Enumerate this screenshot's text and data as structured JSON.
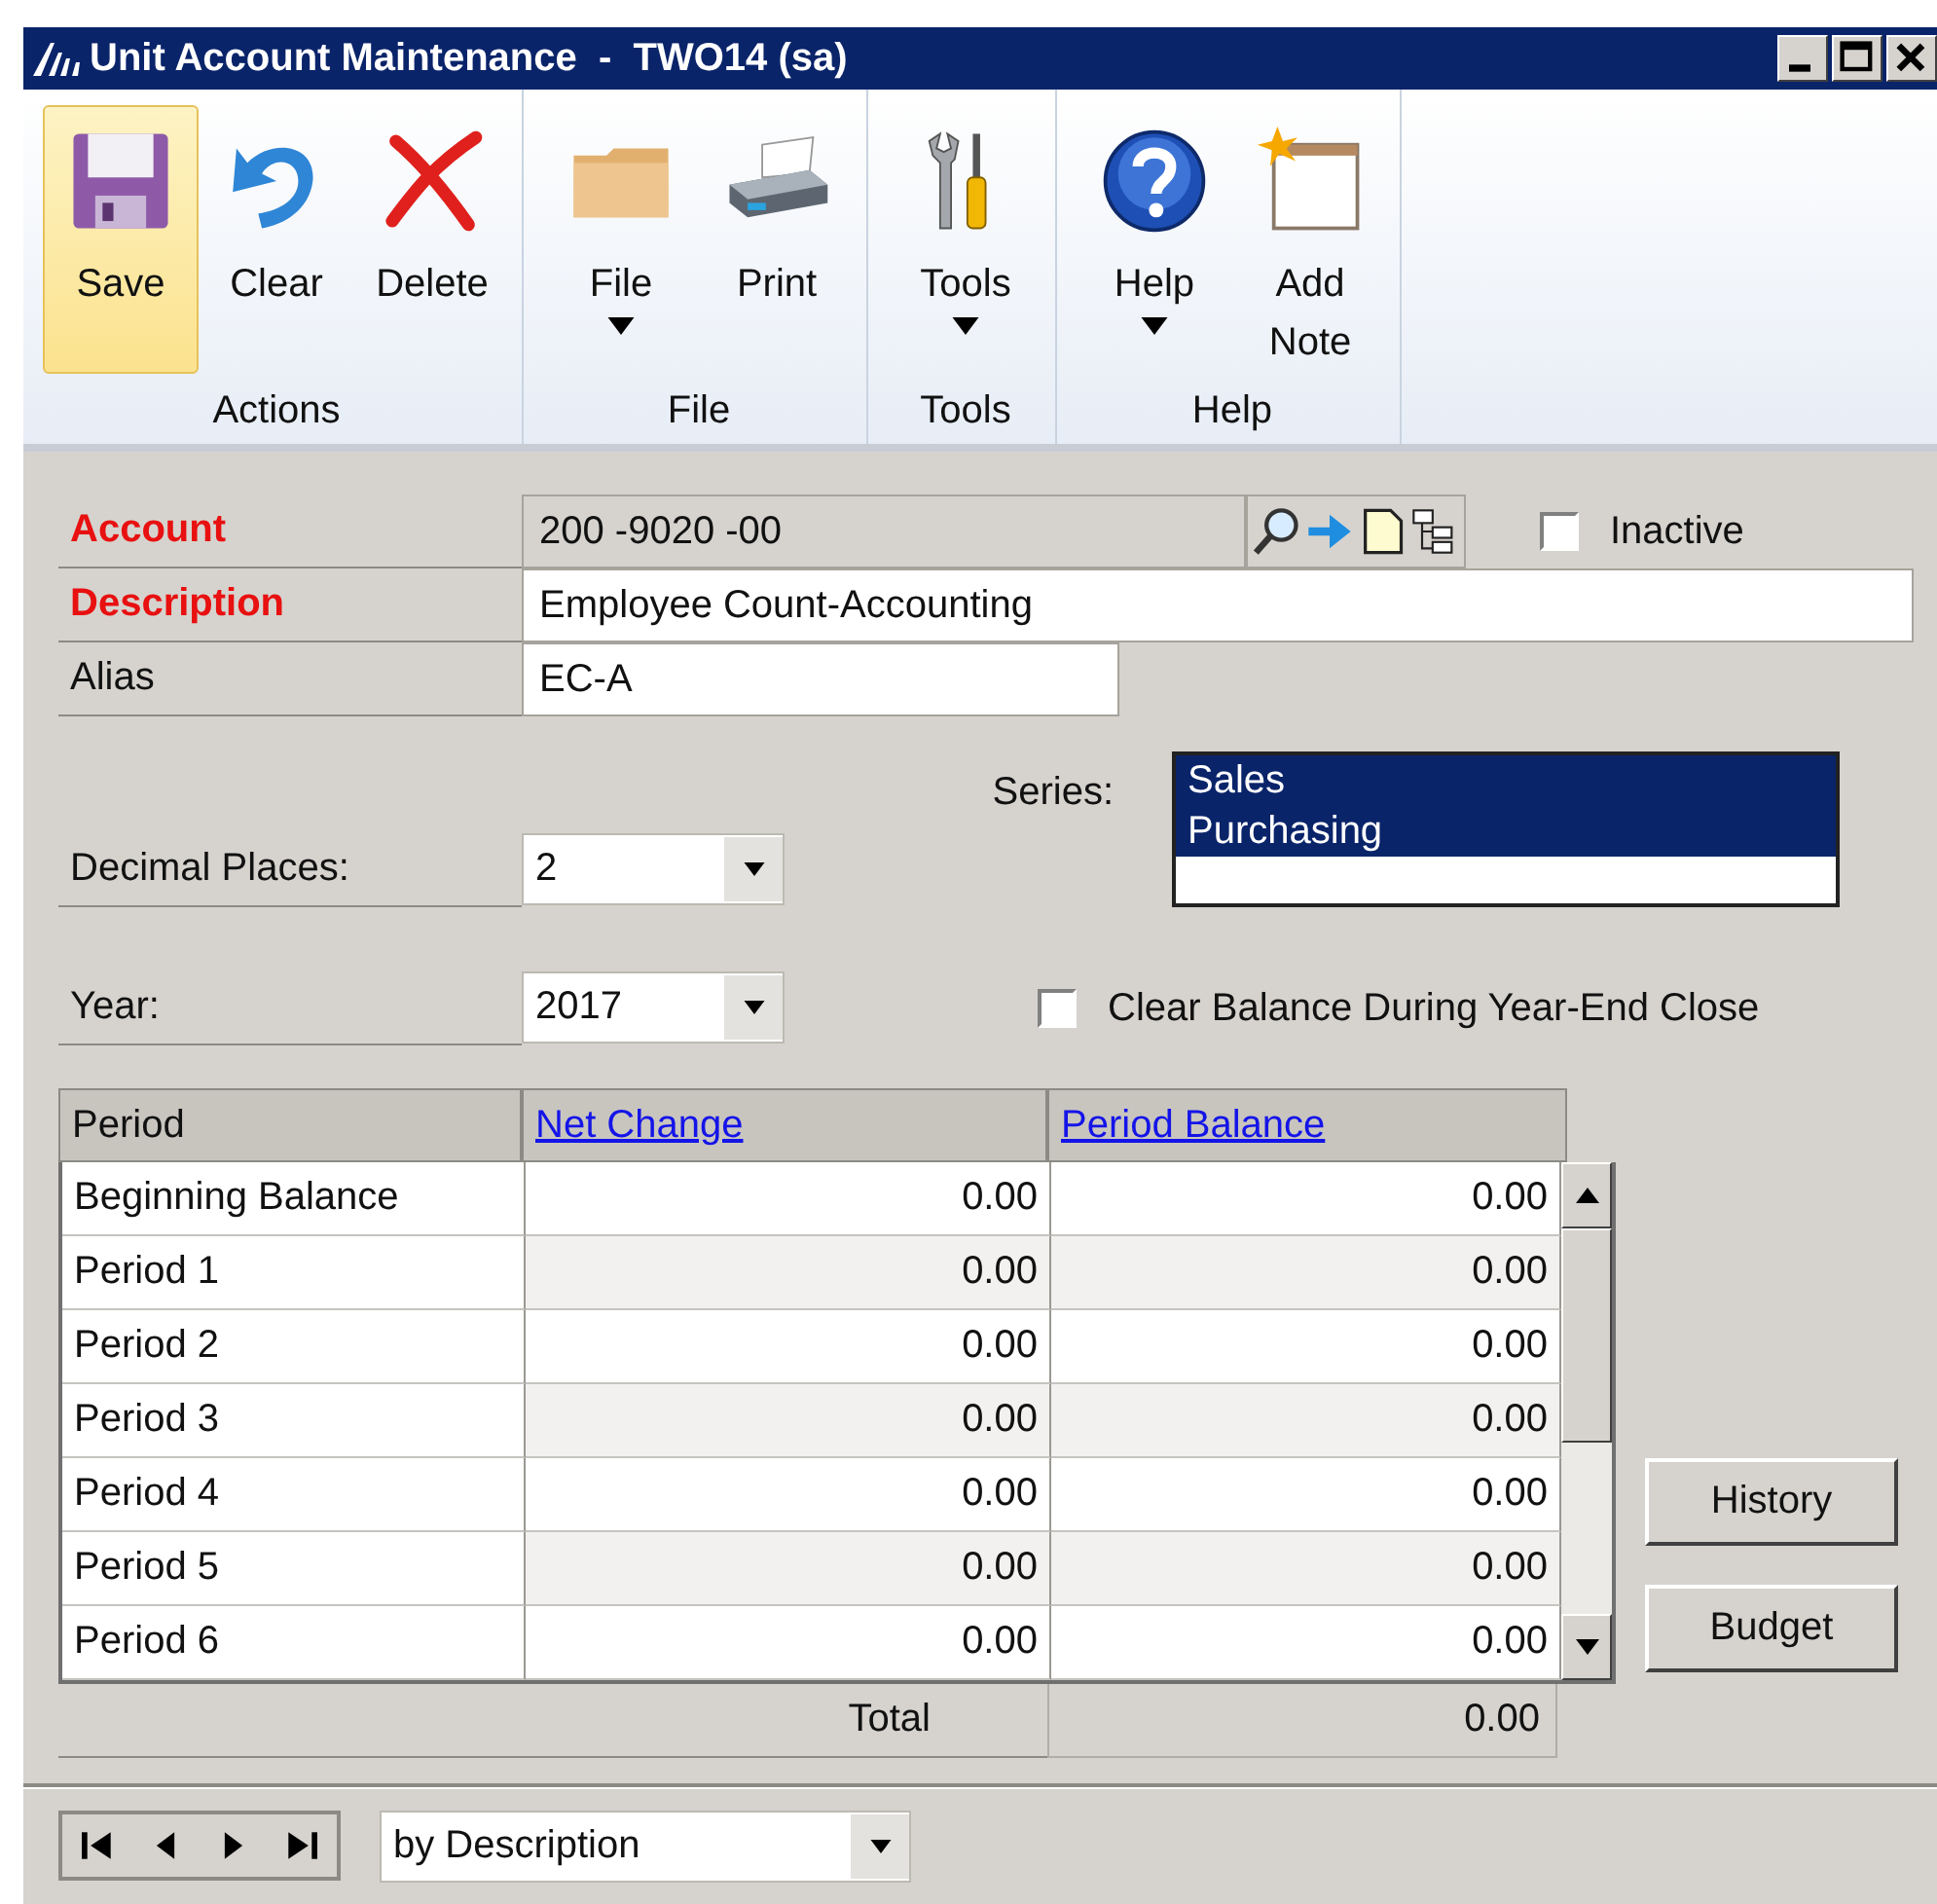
{
  "window": {
    "title": "Unit Account Maintenance  -  TWO14 (sa)"
  },
  "ribbon": {
    "groups": [
      {
        "label": "Actions",
        "buttons": [
          {
            "label": "Save",
            "kind": "save",
            "selected": true,
            "dropdown": false
          },
          {
            "label": "Clear",
            "kind": "clear",
            "selected": false,
            "dropdown": false
          },
          {
            "label": "Delete",
            "kind": "delete",
            "selected": false,
            "dropdown": false
          }
        ]
      },
      {
        "label": "File",
        "buttons": [
          {
            "label": "File",
            "kind": "folder",
            "selected": false,
            "dropdown": true
          },
          {
            "label": "Print",
            "kind": "print",
            "selected": false,
            "dropdown": false
          }
        ]
      },
      {
        "label": "Tools",
        "buttons": [
          {
            "label": "Tools",
            "kind": "tools",
            "selected": false,
            "dropdown": true
          }
        ]
      },
      {
        "label": "Help",
        "buttons": [
          {
            "label": "Help",
            "kind": "help",
            "selected": false,
            "dropdown": true
          },
          {
            "label": "Add Note",
            "kind": "note",
            "selected": false,
            "dropdown": false
          }
        ]
      }
    ]
  },
  "form": {
    "account": {
      "label": "Account",
      "value": "200 -9020 -00",
      "required": true
    },
    "description": {
      "label": "Description",
      "value": "Employee Count-Accounting",
      "required": true
    },
    "alias": {
      "label": "Alias",
      "value": "EC-A",
      "required": false
    },
    "inactive": {
      "label": "Inactive",
      "checked": false
    },
    "series": {
      "label": "Series:",
      "items": [
        {
          "label": "Sales",
          "selected": true
        },
        {
          "label": "Purchasing",
          "selected": true
        }
      ]
    },
    "decimal_places": {
      "label": "Decimal Places:",
      "value": "2"
    },
    "year": {
      "label": "Year:",
      "value": "2017"
    },
    "clear_balance": {
      "label": "Clear Balance During Year-End Close",
      "checked": false
    }
  },
  "table": {
    "columns": [
      {
        "label": "Period",
        "link": false
      },
      {
        "label": "Net Change",
        "link": true
      },
      {
        "label": "Period Balance",
        "link": true
      }
    ],
    "rows": [
      {
        "period": "Beginning Balance",
        "net_change": "0.00",
        "period_balance": "0.00"
      },
      {
        "period": "Period 1",
        "net_change": "0.00",
        "period_balance": "0.00"
      },
      {
        "period": "Period 2",
        "net_change": "0.00",
        "period_balance": "0.00"
      },
      {
        "period": "Period 3",
        "net_change": "0.00",
        "period_balance": "0.00"
      },
      {
        "period": "Period 4",
        "net_change": "0.00",
        "period_balance": "0.00"
      },
      {
        "period": "Period 5",
        "net_change": "0.00",
        "period_balance": "0.00"
      },
      {
        "period": "Period 6",
        "net_change": "0.00",
        "period_balance": "0.00"
      }
    ],
    "total": {
      "label": "Total",
      "value": "0.00"
    }
  },
  "buttons": [
    "History",
    "Budget"
  ],
  "navigation": {
    "sort": "by Description"
  }
}
